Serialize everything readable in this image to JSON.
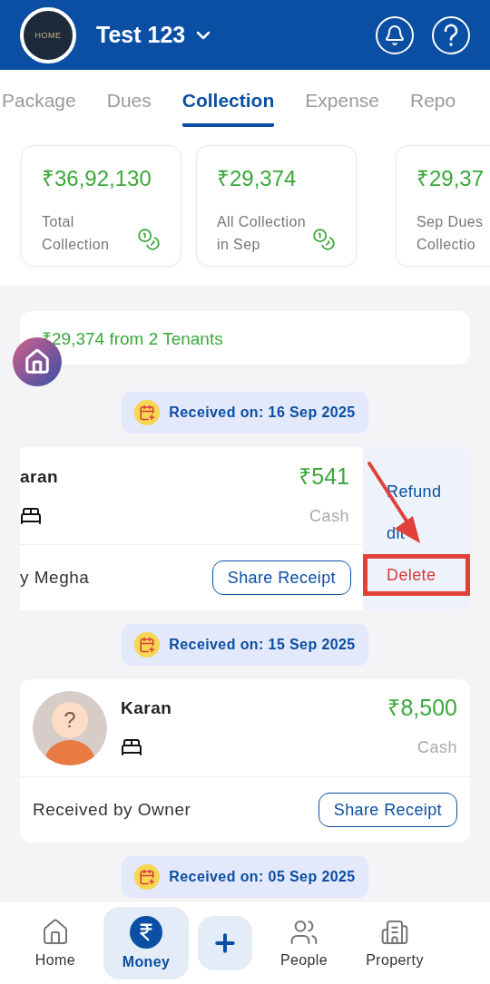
{
  "header": {
    "logo_text": "HOME",
    "title": "Test 123"
  },
  "tabs": [
    {
      "label": "Package",
      "selected": false
    },
    {
      "label": "Dues",
      "selected": false
    },
    {
      "label": "Collection",
      "selected": true
    },
    {
      "label": "Expense",
      "selected": false
    },
    {
      "label": "Repo",
      "selected": false
    }
  ],
  "stats": [
    {
      "amount": "₹36,92,130",
      "lines": [
        "Total",
        "Collection"
      ],
      "coins": true
    },
    {
      "amount": "₹29,374",
      "lines": [
        "All Collection",
        "in Sep"
      ],
      "coins": true
    },
    {
      "amount": "₹29,37",
      "lines": [
        "Sep Dues",
        "Collectio"
      ],
      "coins": false
    }
  ],
  "summary": "₹29,374 from 2 Tenants",
  "days": [
    {
      "date": "Received on: 16 Sep 2025",
      "payments": [
        {
          "swiped": true,
          "name": "aran",
          "amount": "₹541",
          "method": "Cash",
          "received_by": "y Megha",
          "button": "Share Receipt",
          "actions": [
            {
              "label": "Refund",
              "kind": "normal",
              "highlighted": false
            },
            {
              "label": "dit",
              "kind": "normal",
              "highlighted": false
            },
            {
              "label": "Delete",
              "kind": "danger",
              "highlighted": true
            }
          ]
        }
      ]
    },
    {
      "date": "Received on: 15 Sep 2025",
      "payments": [
        {
          "swiped": false,
          "avatar_mark": "?",
          "name": "Karan",
          "amount": "₹8,500",
          "method": "Cash",
          "received_by": "Received by Owner",
          "button": "Share Receipt"
        }
      ]
    },
    {
      "date": "Received on: 05 Sep 2025"
    }
  ],
  "bottom_nav": [
    {
      "label": "Home",
      "kind": "home",
      "selected": false
    },
    {
      "label": "Money",
      "kind": "money",
      "selected": true
    },
    {
      "kind": "add"
    },
    {
      "label": "People",
      "kind": "people",
      "selected": false
    },
    {
      "label": "Property",
      "kind": "property",
      "selected": false
    }
  ]
}
